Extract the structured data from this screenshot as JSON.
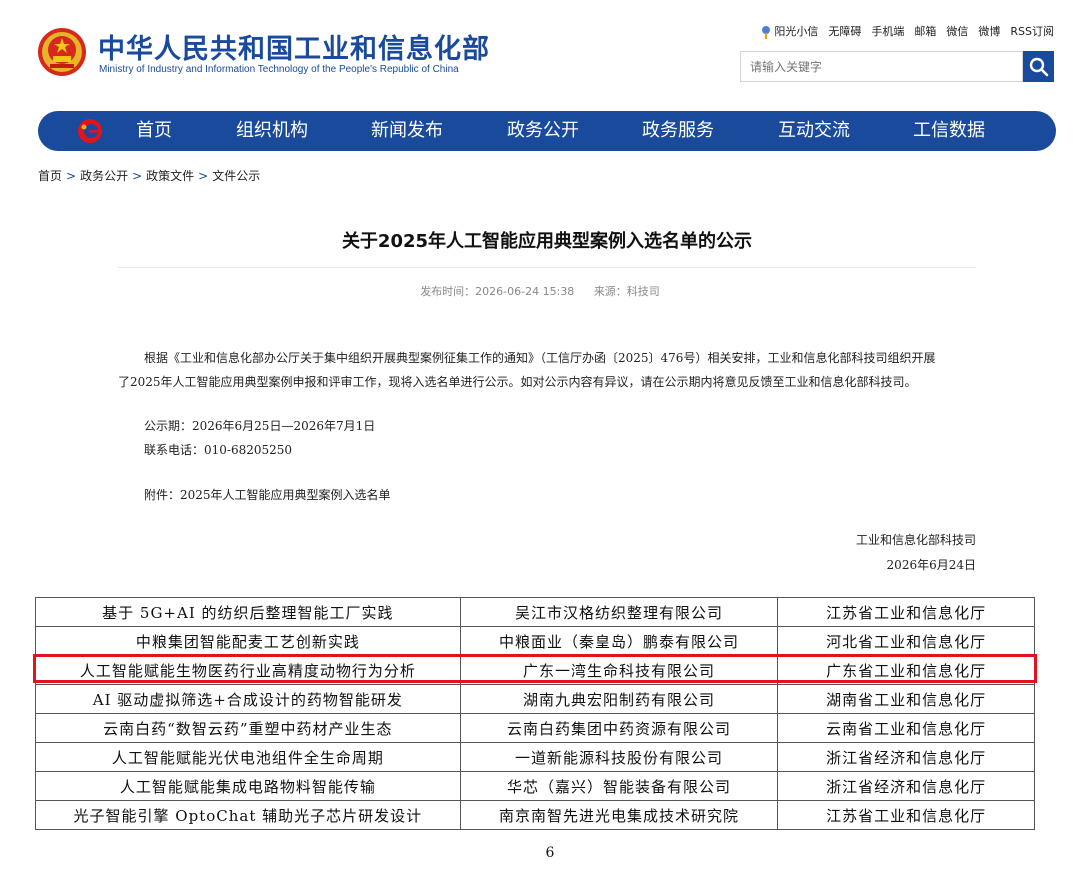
{
  "header": {
    "title": "中华人民共和国工业和信息化部",
    "subtitle": "Ministry of Industry and Information Technology of the People's Republic of China",
    "top_links": [
      "阳光小信",
      "无障碍",
      "手机端",
      "邮箱",
      "微信",
      "微博",
      "RSS订阅"
    ],
    "search_placeholder": "请输入关键字",
    "accent_color": "#1a4a9c"
  },
  "nav": {
    "items": [
      "首页",
      "组织机构",
      "新闻发布",
      "政务公开",
      "政务服务",
      "互动交流",
      "工信数据"
    ]
  },
  "breadcrumb": [
    "首页",
    "政务公开",
    "政策文件",
    "文件公示"
  ],
  "article": {
    "title": "关于2025年人工智能应用典型案例入选名单的公示",
    "publish_label": "发布时间：2026-06-24 15:38",
    "source_label": "来源：科技司",
    "paragraph_line1": "根据《工业和信息化部办公厅关于集中组织开展典型案例征集工作的通知》（工信厅办函〔2025〕476号）相关安排，工业和信息化部科技司组织开展",
    "paragraph_line2": "了2025年人工智能应用典型案例申报和评审工作，现将入选名单进行公示。如对公示内容有异议，请在公示期内将意见反馈至工业和信息化部科技司。",
    "period": "公示期：2026年6月25日—2026年7月1日",
    "phone": "联系电话：010-68205250",
    "attachment": "附件：2025年人工智能应用典型案例入选名单",
    "signoff_org": "工业和信息化部科技司",
    "signoff_date": "2026年6月24日"
  },
  "table": {
    "rows": [
      [
        "基于 5G+AI 的纺织后整理智能工厂实践",
        "吴江市汉格纺织整理有限公司",
        "江苏省工业和信息化厅"
      ],
      [
        "中粮集团智能配麦工艺创新实践",
        "中粮面业（秦皇岛）鹏泰有限公司",
        "河北省工业和信息化厅"
      ],
      [
        "人工智能赋能生物医药行业高精度动物行为分析",
        "广东一湾生命科技有限公司",
        "广东省工业和信息化厅"
      ],
      [
        "AI 驱动虚拟筛选+合成设计的药物智能研发",
        "湖南九典宏阳制药有限公司",
        "湖南省工业和信息化厅"
      ],
      [
        "云南白药“数智云药”重塑中药材产业生态",
        "云南白药集团中药资源有限公司",
        "云南省工业和信息化厅"
      ],
      [
        "人工智能赋能光伏电池组件全生命周期",
        "一道新能源科技股份有限公司",
        "浙江省经济和信息化厅"
      ],
      [
        "人工智能赋能集成电路物料智能传输",
        "华芯（嘉兴）智能装备有限公司",
        "浙江省经济和信息化厅"
      ],
      [
        "光子智能引擎 OptoChat 辅助光子芯片研发设计",
        "南京南智先进光电集成技术研究院",
        "江苏省工业和信息化厅"
      ]
    ],
    "highlight_color": "#e4131b"
  },
  "page_number": "6"
}
